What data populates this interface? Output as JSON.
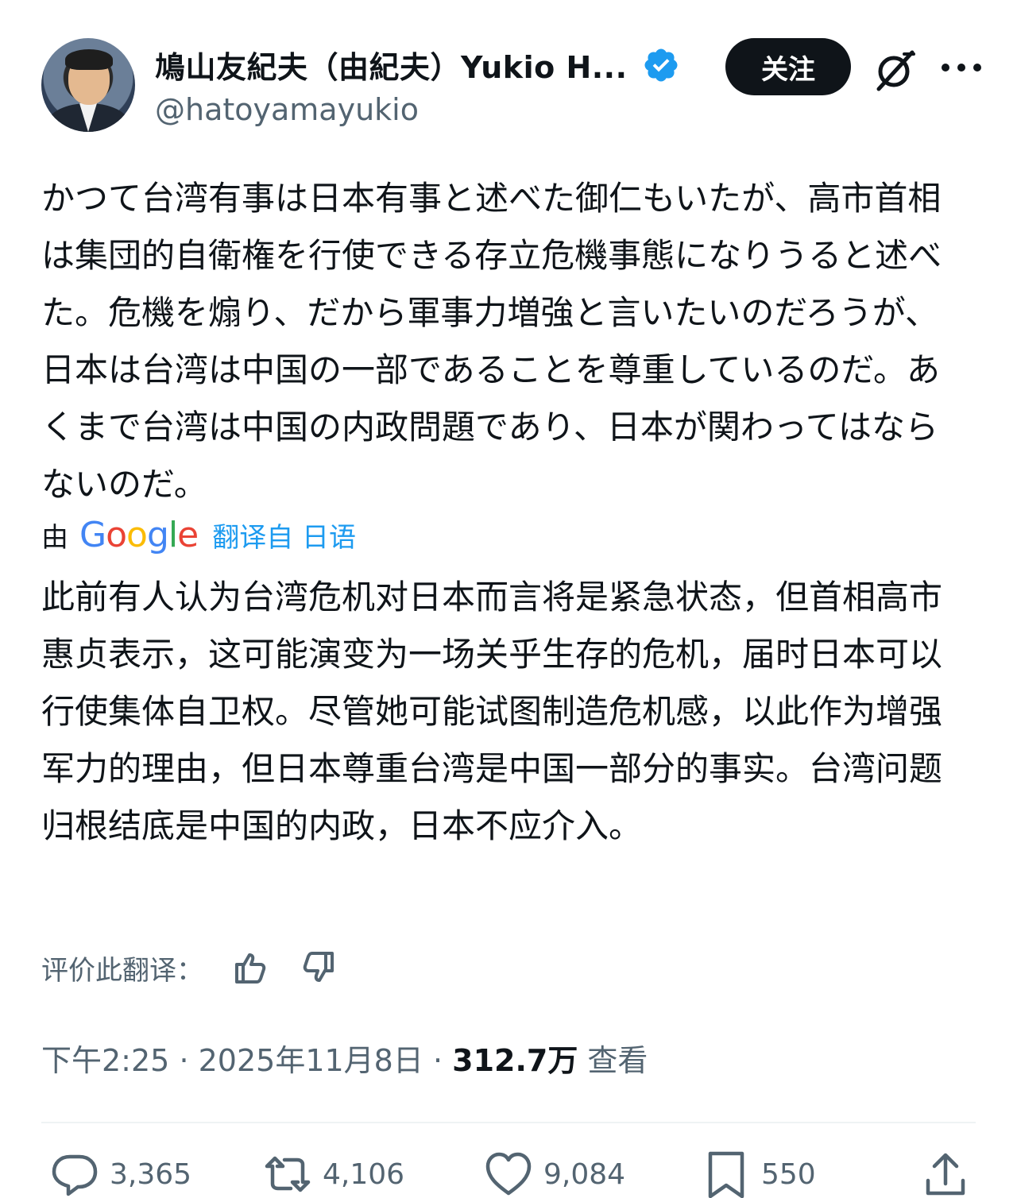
{
  "author": {
    "display_name": "鳩山友紀夫（由紀夫）Yukio H...",
    "handle": "@hatoyamayukio",
    "follow_label": "关注",
    "verified": true
  },
  "icons": {
    "verified": "verified-badge-icon",
    "grok": "grok-icon",
    "more": "more-icon",
    "thumbs_up": "thumbs-up-icon",
    "thumbs_down": "thumbs-down-icon",
    "reply": "reply-icon",
    "repost": "repost-icon",
    "like": "like-icon",
    "bookmark": "bookmark-icon",
    "share": "share-icon"
  },
  "post": {
    "original_text": "かつて台湾有事は日本有事と述べた御仁もいたが、高市首相は集団的自衛権を行使できる存立危機事態になりうると述べた。危機を煽り、だから軍事力増強と言いたいのだろうが、日本は台湾は中国の一部であることを尊重しているのだ。あくまで台湾は中国の内政問題であり、日本が関わってはならないのだ。",
    "translated_by_label": "由",
    "translator": "Google",
    "translate_link": "翻译自 日语",
    "translated_text": "此前有人认为台湾危机对日本而言将是紧急状态，但首相高市惠贞表示，这可能演变为一场关乎生存的危机，届时日本可以行使集体自卫权。尽管她可能试图制造危机感，以此作为增强军力的理由，但日本尊重台湾是中国一部分的事实。台湾问题归根结底是中国的内政，日本不应介入。",
    "rate_label": "评价此翻译："
  },
  "meta": {
    "time": "下午2:25",
    "date": "2025年11月8日",
    "views_count": "312.7万",
    "views_label": "查看",
    "separator": "·"
  },
  "actions": {
    "replies": "3,365",
    "reposts": "4,106",
    "likes": "9,084",
    "bookmarks": "550"
  },
  "colors": {
    "text": "#0f1419",
    "secondary": "#536471",
    "link": "#1d9bf0",
    "follow_bg": "#0f1419",
    "divider": "#eff3f4"
  }
}
